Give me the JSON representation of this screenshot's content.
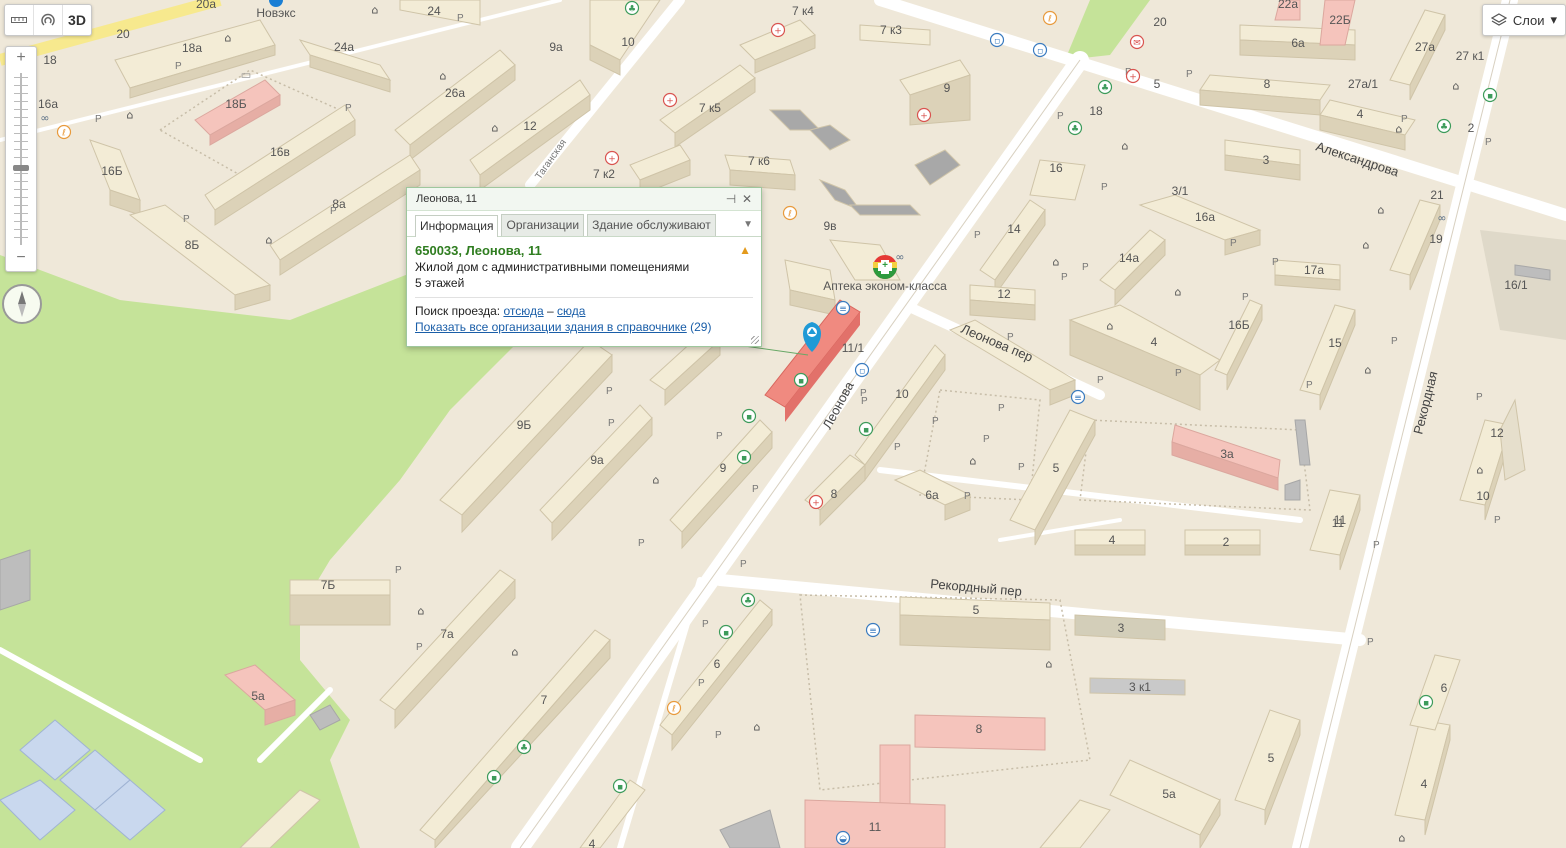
{
  "map": {
    "poi_pharmacy": "Аптека эконом-класса",
    "poi_top": "Новэкс",
    "streets": {
      "leonova": "Леонова",
      "leonova_per": "Леонова пер",
      "rekordny_per": "Рекордный пер",
      "rekordnaya": "Рекордная",
      "aleksandrova": "Александрова",
      "taganskaya": "Таганская"
    },
    "house_numbers": [
      "20а",
      "24",
      "20",
      "18",
      "18а",
      "24а",
      "9а",
      "10",
      "7 к4",
      "7 к3",
      "20",
      "22а",
      "22Б",
      "26а",
      "16а",
      "18Б",
      "12",
      "7 к5",
      "9",
      "6а",
      "8",
      "27а",
      "27а/1",
      "27 к1",
      "16Б",
      "16в",
      "7 к2",
      "7 к6",
      "18",
      "5",
      "4",
      "2",
      "3",
      "8а",
      "9в",
      "16",
      "3/1",
      "16а",
      "21",
      "19",
      "8Б",
      "14",
      "14а",
      "17а",
      "16/1",
      "12",
      "16Б",
      "4",
      "15",
      "11",
      "11/1",
      "9Б",
      "10",
      "9а",
      "9",
      "3а",
      "12",
      "5",
      "6а",
      "10",
      "8",
      "4",
      "2",
      "11",
      "7Б",
      "Рекордный пер",
      "5",
      "3",
      "7а",
      "6",
      "3 к1",
      "6",
      "5а",
      "7",
      "8",
      "5",
      "5а",
      "4",
      "11",
      "4"
    ],
    "letter_p": "P"
  },
  "toolbar": {
    "btn_3d": "3D",
    "ruler_icon": "ruler-icon",
    "magnifier_icon": "magnifier-icon"
  },
  "zoom": {
    "plus": "+",
    "minus": "−",
    "level": 0.45
  },
  "layers": {
    "label": "Слои",
    "arrow": "▾"
  },
  "balloon": {
    "title": "Леонова, 11",
    "tabs": [
      "Информация",
      "Организации",
      "Здание обслуживают"
    ],
    "address": "650033, Леонова, 11",
    "description": "Жилой дом с административными помещениями",
    "floors": "5 этажей",
    "route_label": "Поиск проезда:",
    "route_from": "отсюда",
    "route_dash": "–",
    "route_to": "сюда",
    "org_link": "Показать все организации здания в справочнике",
    "org_count": "(29)"
  },
  "colors": {
    "background": "#efe8d9",
    "road": "#ffffff",
    "park": "#c5e399",
    "building": "#f3ecd6",
    "highlight": "#f08a80",
    "water": "#c9d8ee",
    "pink_building": "#f5c4bc"
  }
}
